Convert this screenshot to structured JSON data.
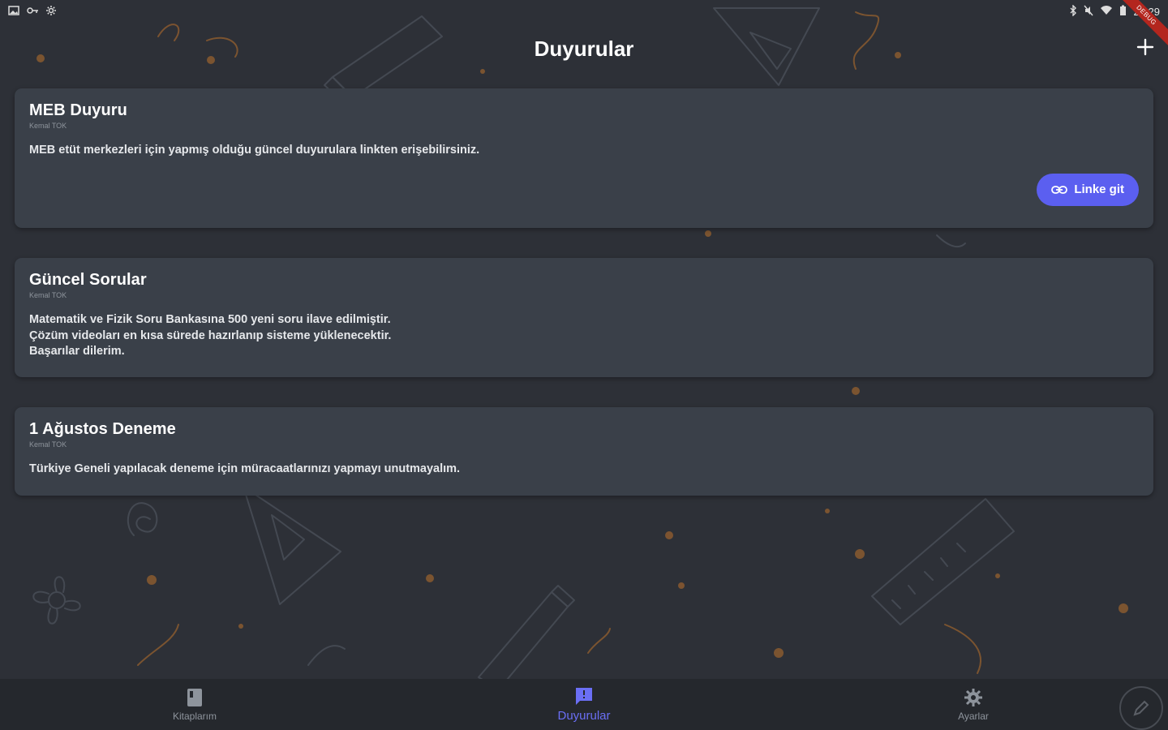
{
  "status_bar": {
    "left_icons": [
      "image-icon",
      "vpn-icon",
      "settings-icon"
    ],
    "right_icons": [
      "bluetooth-icon",
      "mute-icon",
      "wifi-icon",
      "battery-icon"
    ],
    "time": "20:29",
    "debug_banner": "DEBUG"
  },
  "app_bar": {
    "title": "Duyurular",
    "add_icon": "plus-icon"
  },
  "announcements": [
    {
      "title": "MEB Duyuru",
      "author": "Kemal TOK",
      "body": "MEB etüt merkezleri için yapmış olduğu güncel duyurulara linkten erişebilirsiniz.",
      "link_button_label": "Linke git"
    },
    {
      "title": "Güncel Sorular",
      "author": "Kemal TOK",
      "body": "Matematik ve Fizik Soru Bankasına 500 yeni soru ilave edilmiştir.\nÇözüm videoları en kısa sürede hazırlanıp sisteme yüklenecektir.\nBaşarılar dilerim."
    },
    {
      "title": "1 Ağustos Deneme",
      "author": "Kemal TOK",
      "body": "Türkiye Geneli yapılacak deneme için müracaatlarınızı yapmayı unutmayalım."
    }
  ],
  "bottom_nav": {
    "items": [
      {
        "label": "Kitaplarım",
        "icon": "book-icon",
        "active": false
      },
      {
        "label": "Duyurular",
        "icon": "announcement-icon",
        "active": true
      },
      {
        "label": "Ayarlar",
        "icon": "gear-icon",
        "active": false
      }
    ],
    "edit_icon": "pencil-icon"
  },
  "colors": {
    "background": "#2d3037",
    "card": "#3a4049",
    "accent": "#5b5ff0",
    "nav_background": "#25282d",
    "doodle": "#b8763a"
  }
}
